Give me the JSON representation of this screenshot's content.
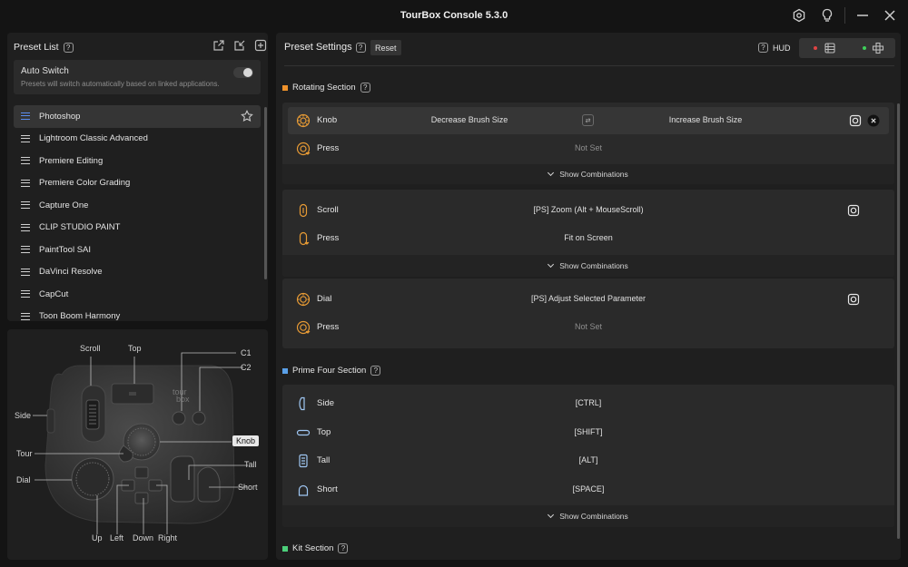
{
  "app": {
    "title": "TourBox Console 5.3.0"
  },
  "preset_list": {
    "header": "Preset List",
    "auto_switch": {
      "label": "Auto Switch",
      "description": "Presets will switch automatically based on linked applications."
    },
    "items": [
      {
        "label": "Photoshop",
        "selected": true
      },
      {
        "label": "Lightroom Classic Advanced"
      },
      {
        "label": "Premiere Editing"
      },
      {
        "label": "Premiere Color Grading"
      },
      {
        "label": "Capture One"
      },
      {
        "label": "CLIP STUDIO PAINT"
      },
      {
        "label": "PaintTool SAI"
      },
      {
        "label": "DaVinci Resolve"
      },
      {
        "label": "CapCut"
      },
      {
        "label": "Toon Boom Harmony"
      }
    ]
  },
  "device": {
    "labels": {
      "scroll": "Scroll",
      "top": "Top",
      "c1": "C1",
      "c2": "C2",
      "side": "Side",
      "tour": "Tour",
      "knob": "Knob",
      "dial": "Dial",
      "tall": "Tall",
      "short": "Short",
      "up": "Up",
      "left": "Left",
      "down": "Down",
      "right": "Right"
    }
  },
  "settings": {
    "header": "Preset Settings",
    "reset_label": "Reset",
    "hud_label": "HUD",
    "rotating_section": {
      "title": "Rotating Section",
      "knob": {
        "name": "Knob",
        "left": "Decrease Brush Size",
        "right": "Increase Brush Size",
        "press_name": "Press",
        "press_value": "Not Set"
      },
      "scroll": {
        "name": "Scroll",
        "value": "[PS] Zoom (Alt + MouseScroll)",
        "press_name": "Press",
        "press_value": "Fit on Screen"
      },
      "dial": {
        "name": "Dial",
        "value": "[PS] Adjust Selected Parameter",
        "press_name": "Press",
        "press_value": "Not Set"
      }
    },
    "prime_four_section": {
      "title": "Prime Four Section",
      "rows": [
        {
          "name": "Side",
          "value": "[CTRL]"
        },
        {
          "name": "Top",
          "value": "[SHIFT]"
        },
        {
          "name": "Tall",
          "value": "[ALT]"
        },
        {
          "name": "Short",
          "value": "[SPACE]"
        }
      ]
    },
    "kit_section": {
      "title": "Kit Section"
    },
    "show_combinations": "Show Combinations"
  },
  "colors": {
    "accent_blue": "#5b8df0",
    "rotating": "#f0922b",
    "prime": "#5aa0e8",
    "kit": "#4ccf7a",
    "hud_red": "#e04444",
    "hud_green": "#3ecf5a"
  }
}
